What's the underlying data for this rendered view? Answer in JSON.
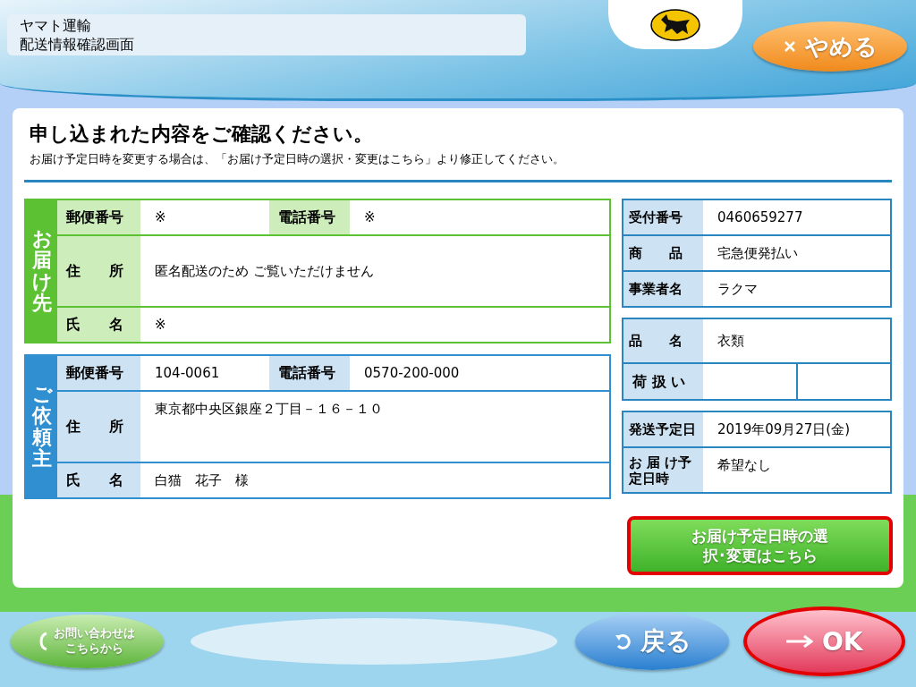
{
  "header": {
    "company": "ヤマト運輸",
    "screen_title": "配送情報確認画面",
    "cancel_button": {
      "label": "やめる",
      "highlighted": false
    }
  },
  "notice": {
    "heading": "申し込まれた内容をご確認ください。",
    "instruction": "お届け予定日時を変更する場合は、「お届け予定日時の選択・変更はこちら」より修正してください。"
  },
  "parties": [
    {
      "label": "お届け先",
      "color": "#5cc233",
      "rows": [
        {
          "kind": "pair",
          "label": "郵便番号",
          "value": "※",
          "label2": "電話番号",
          "value2": "※"
        },
        {
          "kind": "single",
          "label": "住　　所",
          "value": "匿名配送のため ご覧いただけません"
        },
        {
          "kind": "single",
          "label": "氏　　名",
          "value": "※"
        }
      ]
    },
    {
      "label": "ご依頼主",
      "color": "#2f8fd0",
      "rows": [
        {
          "kind": "pair",
          "label": "郵便番号",
          "value": "104-0061",
          "label2": "電話番号",
          "value2": "0570-200-000"
        },
        {
          "kind": "single",
          "label": "住　　所",
          "value": "東京都中央区銀座２丁目－１６－１０"
        },
        {
          "kind": "single",
          "label": "氏　　名",
          "value": "白猫　花子　様"
        }
      ]
    }
  ],
  "details": [
    [
      {
        "kind": "single",
        "label": "受付番号",
        "value": "0460659277"
      },
      {
        "kind": "single",
        "label": "商　　品",
        "value": "宅急便発払い"
      },
      {
        "kind": "single",
        "label": "事業者名",
        "value": "ラクマ"
      }
    ],
    [
      {
        "kind": "single",
        "label": "品　　名",
        "value": "衣類"
      },
      {
        "kind": "split",
        "label": "荷 扱 い"
      }
    ],
    [
      {
        "kind": "single",
        "label": "発送予定日",
        "value": "2019年09月27日(金)"
      },
      {
        "kind": "single",
        "label": "お 届 け予定日時",
        "value": "希望なし"
      }
    ]
  ],
  "change_button": {
    "label": "お届け予定日時の選択･変更はこちら",
    "highlighted": true
  },
  "footer": {
    "contact_button": {
      "label": "お問い合わせはこちらから",
      "highlighted": false
    },
    "back_button": {
      "label": "戻る",
      "highlighted": false
    },
    "ok_button": {
      "label": "OK",
      "highlighted": true
    }
  }
}
